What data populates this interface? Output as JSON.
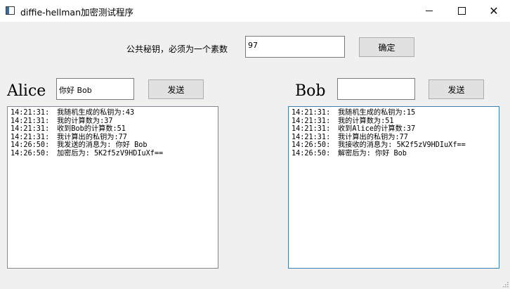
{
  "window": {
    "title": "diffie-hellman加密测试程序"
  },
  "top": {
    "prime_label": "公共秘钥，必须为一个素数",
    "prime_value": "97",
    "confirm_label": "确定"
  },
  "alice": {
    "name": "Alice",
    "message_value": "你好 Bob",
    "send_label": "发送",
    "log": [
      {
        "time": "14:21:31:",
        "text": "我随机生成的私钥为:43"
      },
      {
        "time": "14:21:31:",
        "text": "我的计算数为:37"
      },
      {
        "time": "14:21:31:",
        "text": "收到Bob的计算数:51"
      },
      {
        "time": "14:21:31:",
        "text": "我计算出的私钥为:77"
      },
      {
        "time": "14:26:50:",
        "text": "我发送的消息为: 你好 Bob"
      },
      {
        "time": "14:26:50:",
        "text": "加密后为: 5K2f5zV9HDIuXf=="
      }
    ]
  },
  "bob": {
    "name": "Bob",
    "message_value": "",
    "send_label": "发送",
    "log": [
      {
        "time": "14:21:31:",
        "text": "我随机生成的私钥为:15"
      },
      {
        "time": "14:21:31:",
        "text": "我的计算数为:51"
      },
      {
        "time": "14:21:31:",
        "text": "收到Alice的计算数:37"
      },
      {
        "time": "14:21:31:",
        "text": "我计算出的私钥为:77"
      },
      {
        "time": "14:26:50:",
        "text": "我接收的消息为: 5K2f5zV9HDIuXf=="
      },
      {
        "time": "14:26:50:",
        "text": "解密后为: 你好 Bob"
      }
    ]
  }
}
